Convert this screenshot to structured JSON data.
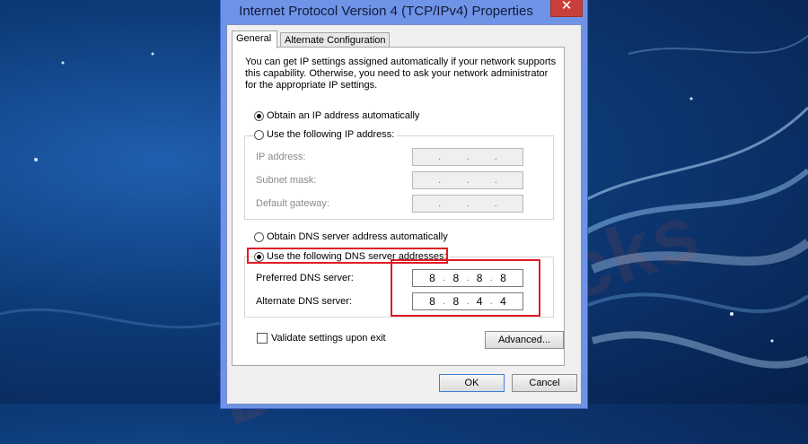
{
  "window": {
    "title": "Internet Protocol Version 4 (TCP/IPv4) Properties",
    "close_glyph": "✕"
  },
  "tabs": [
    {
      "label": "General",
      "active": true
    },
    {
      "label": "Alternate Configuration",
      "active": false
    }
  ],
  "intro_text": "You can get IP settings assigned automatically if your network supports this capability. Otherwise, you need to ask your network administrator for the appropriate IP settings.",
  "ip_section": {
    "auto_label": "Obtain an IP address automatically",
    "manual_label": "Use the following IP address:",
    "selected": "auto",
    "fields": [
      {
        "label": "IP address:",
        "octets": [
          "",
          "",
          "",
          ""
        ]
      },
      {
        "label": "Subnet mask:",
        "octets": [
          "",
          "",
          "",
          ""
        ]
      },
      {
        "label": "Default gateway:",
        "octets": [
          "",
          "",
          "",
          ""
        ]
      }
    ]
  },
  "dns_section": {
    "auto_label": "Obtain DNS server address automatically",
    "manual_label": "Use the following DNS server addresses:",
    "selected": "manual",
    "preferred": {
      "label": "Preferred DNS server:",
      "octets": [
        "8",
        "8",
        "8",
        "8"
      ]
    },
    "alternate": {
      "label": "Alternate DNS server:",
      "octets": [
        "8",
        "8",
        "4",
        "4"
      ]
    }
  },
  "validate_label": "Validate settings upon exit",
  "buttons": {
    "advanced": "Advanced...",
    "ok": "OK",
    "cancel": "Cancel"
  },
  "watermark": "DeviceTricks",
  "colors": {
    "highlight": "#e01b24",
    "title_bar": "#6f93e6",
    "close_button": "#c9403a"
  }
}
